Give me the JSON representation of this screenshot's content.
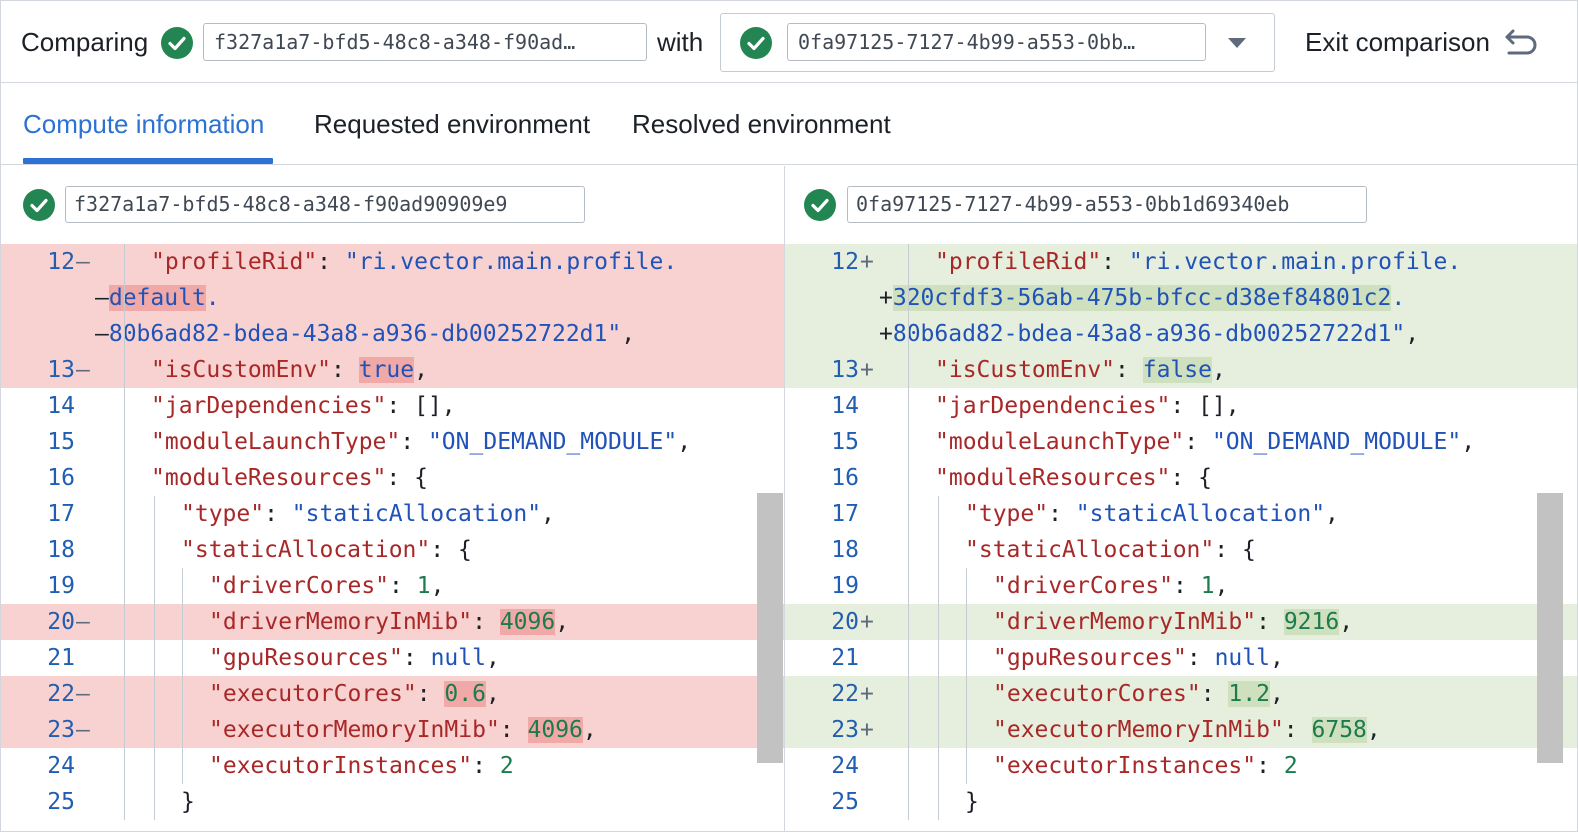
{
  "header": {
    "comparing_label": "Comparing",
    "left_id": "f327a1a7-bfd5-48c8-a348-f90ad…",
    "with_label": "with",
    "right_id": "0fa97125-7127-4b99-a553-0bb…",
    "exit_label": "Exit comparison",
    "exit_icon": "undo-icon",
    "status_icon": "check-circle-icon"
  },
  "tabs": [
    {
      "label": "Compute information",
      "active": true
    },
    {
      "label": "Requested environment",
      "active": false
    },
    {
      "label": "Resolved environment",
      "active": false
    }
  ],
  "left": {
    "id": "f327a1a7-bfd5-48c8-a348-f90ad90909e9",
    "lines": [
      {
        "ln": "12",
        "mark": "—",
        "type": "del",
        "parts": [
          {
            "c": "k",
            "t": "\"profileRid\""
          },
          {
            "c": "p",
            "t": ": "
          },
          {
            "c": "s",
            "t": "\"ri.vector.main.profile."
          }
        ]
      },
      {
        "ln": "",
        "mark": "",
        "type": "del",
        "parts": [
          {
            "c": "p",
            "t": "—"
          },
          {
            "c": "s hl-del",
            "t": "default"
          },
          {
            "c": "s",
            "t": "."
          }
        ]
      },
      {
        "ln": "",
        "mark": "",
        "type": "del",
        "parts": [
          {
            "c": "p",
            "t": "—"
          },
          {
            "c": "s",
            "t": "80b6ad82-bdea-43a8-a936-db00252722d1\""
          },
          {
            "c": "p",
            "t": ","
          }
        ]
      },
      {
        "ln": "13",
        "mark": "—",
        "type": "del",
        "parts": [
          {
            "c": "k",
            "t": "\"isCustomEnv\""
          },
          {
            "c": "p",
            "t": ": "
          },
          {
            "c": "b hl-del",
            "t": "true"
          },
          {
            "c": "p",
            "t": ","
          }
        ]
      },
      {
        "ln": "14",
        "mark": "",
        "type": "ctx",
        "parts": [
          {
            "c": "k",
            "t": "\"jarDependencies\""
          },
          {
            "c": "p",
            "t": ": [],"
          }
        ]
      },
      {
        "ln": "15",
        "mark": "",
        "type": "ctx",
        "parts": [
          {
            "c": "k",
            "t": "\"moduleLaunchType\""
          },
          {
            "c": "p",
            "t": ": "
          },
          {
            "c": "s",
            "t": "\"ON_DEMAND_MODULE\""
          },
          {
            "c": "p",
            "t": ","
          }
        ]
      },
      {
        "ln": "16",
        "mark": "",
        "type": "ctx",
        "parts": [
          {
            "c": "k",
            "t": "\"moduleResources\""
          },
          {
            "c": "p",
            "t": ": {"
          }
        ]
      },
      {
        "ln": "17",
        "mark": "",
        "type": "ctx",
        "parts": [
          {
            "c": "k",
            "t": "\"type\""
          },
          {
            "c": "p",
            "t": ": "
          },
          {
            "c": "s",
            "t": "\"staticAllocation\""
          },
          {
            "c": "p",
            "t": ","
          }
        ]
      },
      {
        "ln": "18",
        "mark": "",
        "type": "ctx",
        "parts": [
          {
            "c": "k",
            "t": "\"staticAllocation\""
          },
          {
            "c": "p",
            "t": ": {"
          }
        ]
      },
      {
        "ln": "19",
        "mark": "",
        "type": "ctx",
        "parts": [
          {
            "c": "k",
            "t": "\"driverCores\""
          },
          {
            "c": "p",
            "t": ": "
          },
          {
            "c": "n",
            "t": "1"
          },
          {
            "c": "p",
            "t": ","
          }
        ]
      },
      {
        "ln": "20",
        "mark": "—",
        "type": "del",
        "parts": [
          {
            "c": "k",
            "t": "\"driverMemoryInMib\""
          },
          {
            "c": "p",
            "t": ": "
          },
          {
            "c": "n hl-del",
            "t": "4096"
          },
          {
            "c": "p",
            "t": ","
          }
        ]
      },
      {
        "ln": "21",
        "mark": "",
        "type": "ctx",
        "parts": [
          {
            "c": "k",
            "t": "\"gpuResources\""
          },
          {
            "c": "p",
            "t": ": "
          },
          {
            "c": "b",
            "t": "null"
          },
          {
            "c": "p",
            "t": ","
          }
        ]
      },
      {
        "ln": "22",
        "mark": "—",
        "type": "del",
        "parts": [
          {
            "c": "k",
            "t": "\"executorCores\""
          },
          {
            "c": "p",
            "t": ": "
          },
          {
            "c": "n hl-del",
            "t": "0.6"
          },
          {
            "c": "p",
            "t": ","
          }
        ]
      },
      {
        "ln": "23",
        "mark": "—",
        "type": "del",
        "parts": [
          {
            "c": "k",
            "t": "\"executorMemoryInMib\""
          },
          {
            "c": "p",
            "t": ": "
          },
          {
            "c": "n hl-del",
            "t": "4096"
          },
          {
            "c": "p",
            "t": ","
          }
        ]
      },
      {
        "ln": "24",
        "mark": "",
        "type": "ctx",
        "parts": [
          {
            "c": "k",
            "t": "\"executorInstances\""
          },
          {
            "c": "p",
            "t": ": "
          },
          {
            "c": "n",
            "t": "2"
          }
        ]
      },
      {
        "ln": "25",
        "mark": "",
        "type": "ctx",
        "parts": [
          {
            "c": "p",
            "t": "}"
          }
        ]
      }
    ]
  },
  "right": {
    "id": "0fa97125-7127-4b99-a553-0bb1d69340eb",
    "lines": [
      {
        "ln": "12",
        "mark": "+",
        "type": "add",
        "parts": [
          {
            "c": "k",
            "t": "\"profileRid\""
          },
          {
            "c": "p",
            "t": ": "
          },
          {
            "c": "s",
            "t": "\"ri.vector.main.profile."
          }
        ]
      },
      {
        "ln": "",
        "mark": "",
        "type": "add",
        "parts": [
          {
            "c": "p",
            "t": "+"
          },
          {
            "c": "s hl-add",
            "t": "320cfdf3-56ab-475b-bfcc-d38ef84801c2"
          },
          {
            "c": "s",
            "t": "."
          }
        ]
      },
      {
        "ln": "",
        "mark": "",
        "type": "add",
        "parts": [
          {
            "c": "p",
            "t": "+"
          },
          {
            "c": "s",
            "t": "80b6ad82-bdea-43a8-a936-db00252722d1\""
          },
          {
            "c": "p",
            "t": ","
          }
        ]
      },
      {
        "ln": "13",
        "mark": "+",
        "type": "add",
        "parts": [
          {
            "c": "k",
            "t": "\"isCustomEnv\""
          },
          {
            "c": "p",
            "t": ": "
          },
          {
            "c": "b hl-add",
            "t": "false"
          },
          {
            "c": "p",
            "t": ","
          }
        ]
      },
      {
        "ln": "14",
        "mark": "",
        "type": "ctx",
        "parts": [
          {
            "c": "k",
            "t": "\"jarDependencies\""
          },
          {
            "c": "p",
            "t": ": [],"
          }
        ]
      },
      {
        "ln": "15",
        "mark": "",
        "type": "ctx",
        "parts": [
          {
            "c": "k",
            "t": "\"moduleLaunchType\""
          },
          {
            "c": "p",
            "t": ": "
          },
          {
            "c": "s",
            "t": "\"ON_DEMAND_MODULE\""
          },
          {
            "c": "p",
            "t": ","
          }
        ]
      },
      {
        "ln": "16",
        "mark": "",
        "type": "ctx",
        "parts": [
          {
            "c": "k",
            "t": "\"moduleResources\""
          },
          {
            "c": "p",
            "t": ": {"
          }
        ]
      },
      {
        "ln": "17",
        "mark": "",
        "type": "ctx",
        "parts": [
          {
            "c": "k",
            "t": "\"type\""
          },
          {
            "c": "p",
            "t": ": "
          },
          {
            "c": "s",
            "t": "\"staticAllocation\""
          },
          {
            "c": "p",
            "t": ","
          }
        ]
      },
      {
        "ln": "18",
        "mark": "",
        "type": "ctx",
        "parts": [
          {
            "c": "k",
            "t": "\"staticAllocation\""
          },
          {
            "c": "p",
            "t": ": {"
          }
        ]
      },
      {
        "ln": "19",
        "mark": "",
        "type": "ctx",
        "parts": [
          {
            "c": "k",
            "t": "\"driverCores\""
          },
          {
            "c": "p",
            "t": ": "
          },
          {
            "c": "n",
            "t": "1"
          },
          {
            "c": "p",
            "t": ","
          }
        ]
      },
      {
        "ln": "20",
        "mark": "+",
        "type": "add",
        "parts": [
          {
            "c": "k",
            "t": "\"driverMemoryInMib\""
          },
          {
            "c": "p",
            "t": ": "
          },
          {
            "c": "n hl-add",
            "t": "9216"
          },
          {
            "c": "p",
            "t": ","
          }
        ]
      },
      {
        "ln": "21",
        "mark": "",
        "type": "ctx",
        "parts": [
          {
            "c": "k",
            "t": "\"gpuResources\""
          },
          {
            "c": "p",
            "t": ": "
          },
          {
            "c": "b",
            "t": "null"
          },
          {
            "c": "p",
            "t": ","
          }
        ]
      },
      {
        "ln": "22",
        "mark": "+",
        "type": "add",
        "parts": [
          {
            "c": "k",
            "t": "\"executorCores\""
          },
          {
            "c": "p",
            "t": ": "
          },
          {
            "c": "n hl-add",
            "t": "1.2"
          },
          {
            "c": "p",
            "t": ","
          }
        ]
      },
      {
        "ln": "23",
        "mark": "+",
        "type": "add",
        "parts": [
          {
            "c": "k",
            "t": "\"executorMemoryInMib\""
          },
          {
            "c": "p",
            "t": ": "
          },
          {
            "c": "n hl-add",
            "t": "6758"
          },
          {
            "c": "p",
            "t": ","
          }
        ]
      },
      {
        "ln": "24",
        "mark": "",
        "type": "ctx",
        "parts": [
          {
            "c": "k",
            "t": "\"executorInstances\""
          },
          {
            "c": "p",
            "t": ": "
          },
          {
            "c": "n",
            "t": "2"
          }
        ]
      },
      {
        "ln": "25",
        "mark": "",
        "type": "ctx",
        "parts": [
          {
            "c": "p",
            "t": "}"
          }
        ]
      }
    ]
  },
  "colors": {
    "accent": "#2d72d2",
    "success": "#238551",
    "deleted_bg": "#f8d2d1",
    "added_bg": "#e6eedd"
  }
}
